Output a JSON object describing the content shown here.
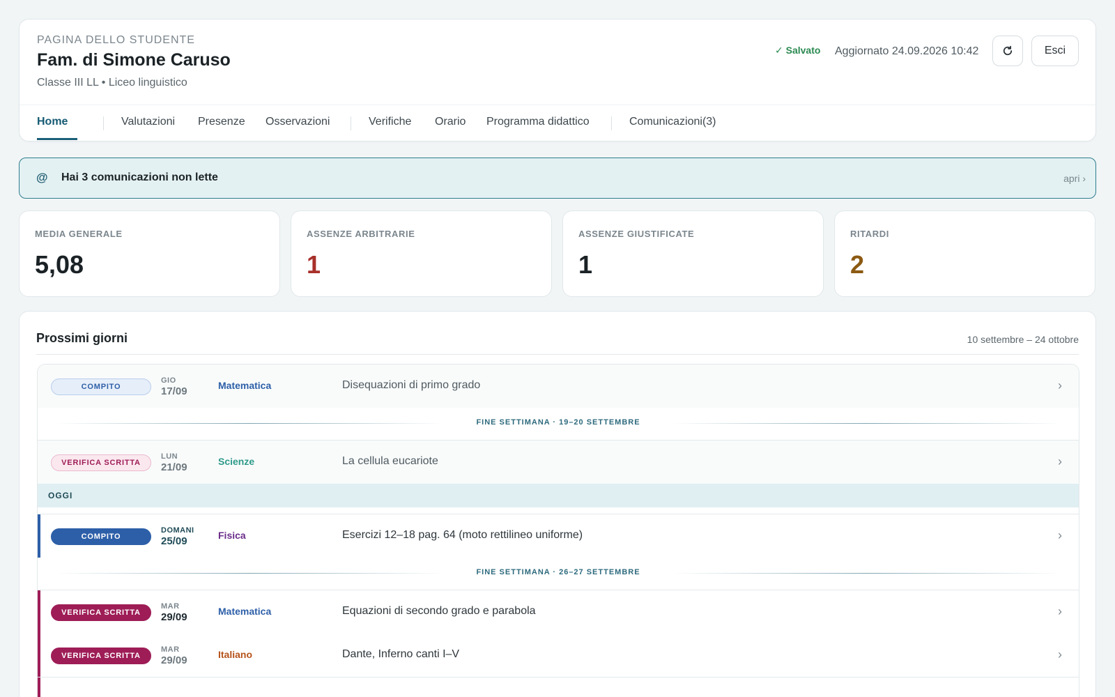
{
  "header": {
    "eyebrow": "PAGINA DELLO STUDENTE",
    "title": "Fam. di Simone Caruso",
    "subtitle": "Classe III LL • Liceo linguistico",
    "saved": "✓ Salvato",
    "updated": "Aggiornato 24.09.2026 10:42",
    "refresh_icon": "refresh-icon",
    "logout_label": "Esci"
  },
  "nav": {
    "tabs": [
      {
        "label": "Home",
        "active": true
      },
      {
        "label": "Valutazioni"
      },
      {
        "label": "Presenze"
      },
      {
        "label": "Osservazioni"
      },
      {
        "label": "Verifiche"
      },
      {
        "label": "Orario"
      },
      {
        "label": "Programma didattico"
      },
      {
        "label": "Comunicazioni(3)"
      }
    ]
  },
  "alert": {
    "icon": "@",
    "text": "Hai 3 comunicazioni non lette",
    "link": "apri ›"
  },
  "stats": [
    {
      "label": "MEDIA GENERALE",
      "value": "5,08",
      "color": "#1b2226"
    },
    {
      "label": "ASSENZE ARBITRARIE",
      "value": "1",
      "color": "#a8302a"
    },
    {
      "label": "ASSENZE GIUSTIFICATE",
      "value": "1",
      "color": "#1b2226"
    },
    {
      "label": "RITARDI",
      "value": "2",
      "color": "#8c5a12"
    }
  ],
  "upcoming": {
    "title": "Prossimi giorni",
    "range": "10 settembre – 24 ottobre",
    "today_label": "OGGI",
    "weekends": [
      "FINE SETTIMANA · 19–20 SETTEMBRE",
      "FINE SETTIMANA · 26–27 SETTEMBRE"
    ],
    "events": [
      {
        "type": "COMPITO",
        "day": "GIO",
        "date": "17/09",
        "subject": "Matematica",
        "description": "Disequazioni di primo grado",
        "chevron": "›"
      },
      {
        "type": "VERIFICA SCRITTA",
        "day": "LUN",
        "date": "21/09",
        "subject": "Scienze",
        "description": "La cellula eucariote",
        "chevron": "›"
      },
      {
        "type": "COMPITO",
        "day": "DOMANI",
        "date": "25/09",
        "subject": "Fisica",
        "description": "Esercizi 12–18 pag. 64 (moto rettilineo uniforme)",
        "chevron": "›"
      },
      {
        "type": "VERIFICA SCRITTA",
        "day": "MAR",
        "date": "29/09",
        "subject": "Matematica",
        "description": "Equazioni di secondo grado e parabola",
        "chevron": "›"
      },
      {
        "type": "VERIFICA SCRITTA",
        "day": "MAR",
        "date": "29/09",
        "subject": "Italiano",
        "description": "Dante, Inferno canti I–V",
        "chevron": "›"
      }
    ]
  },
  "colors": {
    "accent": "#1b5f78",
    "compito_pill": "#2d5fa8",
    "verifica_pill": "#9e1d57",
    "matematica": "#2d5fa8",
    "scienze": "#2e9a8a",
    "fisica": "#6a2d8a",
    "italiano": "#b5531a"
  }
}
